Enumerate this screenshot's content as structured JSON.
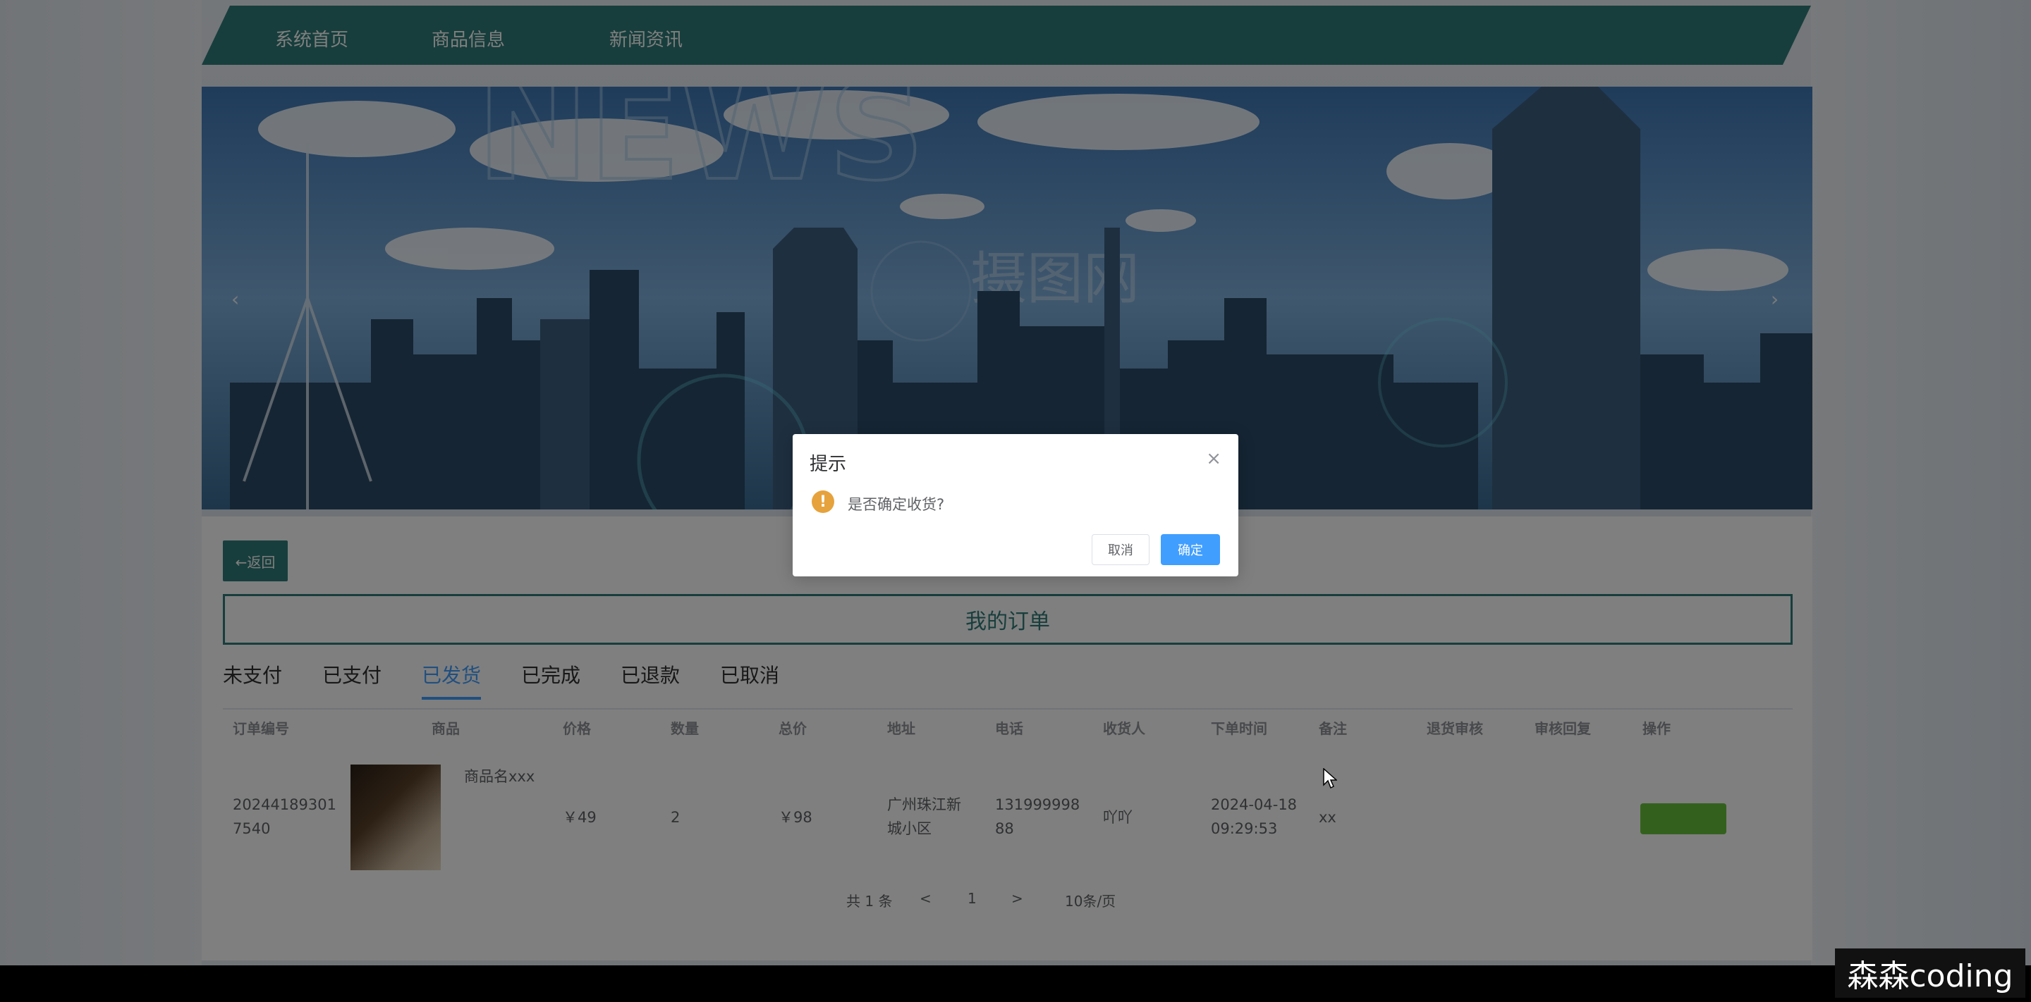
{
  "nav": {
    "items": [
      "系统首页",
      "商品信息",
      "新闻资讯"
    ]
  },
  "banner": {
    "prev_glyph": "‹",
    "next_glyph": "›",
    "watermark_text": "NEWS",
    "stock_watermark": "摄图网"
  },
  "main": {
    "back_label": "←返回",
    "title": "我的订单",
    "tabs": [
      {
        "label": "未支付",
        "active": false
      },
      {
        "label": "已支付",
        "active": false
      },
      {
        "label": "已发货",
        "active": true
      },
      {
        "label": "已完成",
        "active": false
      },
      {
        "label": "已退款",
        "active": false
      },
      {
        "label": "已取消",
        "active": false
      }
    ],
    "columns": [
      "订单编号",
      "商品",
      "价格",
      "数量",
      "总价",
      "地址",
      "电话",
      "收货人",
      "下单时间",
      "备注",
      "退货审核",
      "审核回复",
      "操作"
    ],
    "rows": [
      {
        "order_no_line1": "20244189301",
        "order_no_line2": "7540",
        "product_name": "商品名xxx",
        "price": "￥49",
        "quantity": "2",
        "total": "￥98",
        "address_line1": "广州珠江新",
        "address_line2": "城小区",
        "phone_line1": "131999998",
        "phone_line2": "88",
        "receiver": "吖吖",
        "time_line1": "2024-04-18",
        "time_line2": "09:29:53",
        "remark": "xx"
      }
    ],
    "pagination": {
      "total": "共 1 条",
      "prev": "<",
      "page": "1",
      "next": ">",
      "page_size": "10条/页"
    }
  },
  "dialog": {
    "title": "提示",
    "close_glyph": "×",
    "icon_glyph": "!",
    "message": "是否确定收货?",
    "cancel_label": "取消",
    "confirm_label": "确定"
  },
  "watermark": "森森coding",
  "colors": {
    "nav": "#2f7d78",
    "primary": "#409eff",
    "warning": "#e6a23c",
    "success": "#67c23a"
  }
}
